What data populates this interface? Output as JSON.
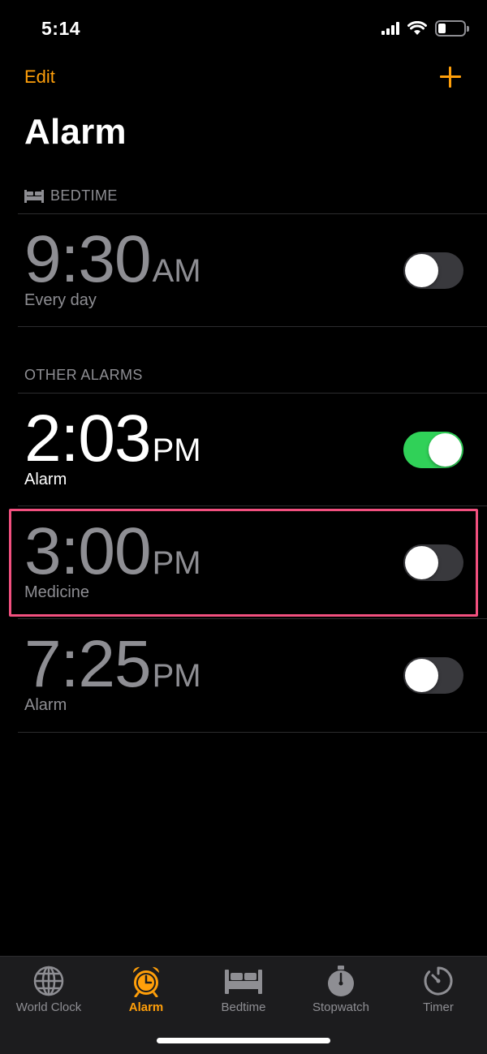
{
  "status_bar": {
    "time": "5:14",
    "battery_level": 0.3
  },
  "nav": {
    "edit_label": "Edit",
    "add_icon": "plus-icon"
  },
  "page": {
    "title": "Alarm"
  },
  "bedtime_section": {
    "header": "BEDTIME",
    "icon": "bed-icon",
    "alarm": {
      "time": "9:30",
      "ampm": "AM",
      "label": "Every day",
      "enabled": false
    }
  },
  "other_section": {
    "header": "OTHER ALARMS",
    "alarms": [
      {
        "time": "2:03",
        "ampm": "PM",
        "label": "Alarm",
        "enabled": true
      },
      {
        "time": "3:00",
        "ampm": "PM",
        "label": "Medicine",
        "enabled": false
      },
      {
        "time": "7:25",
        "ampm": "PM",
        "label": "Alarm",
        "enabled": false
      }
    ]
  },
  "tab_bar": {
    "tabs": [
      {
        "label": "World Clock",
        "icon": "globe-icon"
      },
      {
        "label": "Alarm",
        "icon": "alarm-clock-icon"
      },
      {
        "label": "Bedtime",
        "icon": "bed-icon"
      },
      {
        "label": "Stopwatch",
        "icon": "stopwatch-icon"
      },
      {
        "label": "Timer",
        "icon": "timer-icon"
      }
    ],
    "active_index": 1
  },
  "colors": {
    "accent": "#ff9f0a",
    "toggle_on": "#30d158",
    "highlight": "#f2507f",
    "secondary_text": "#8e8e93"
  }
}
